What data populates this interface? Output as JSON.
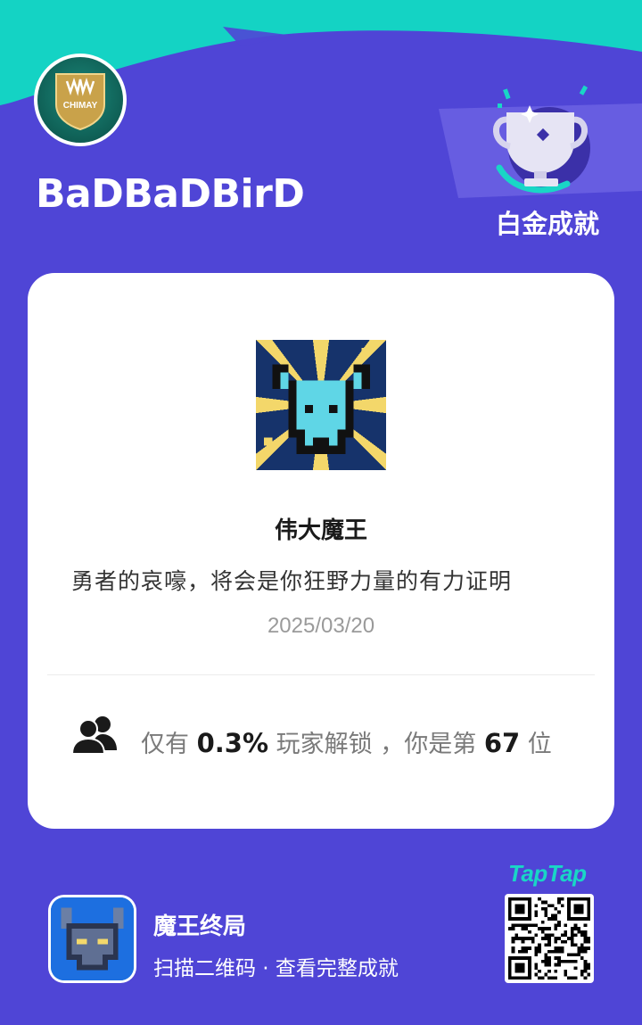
{
  "user": {
    "name": "BaDBaDBirD",
    "avatar_text": "CHIMAY"
  },
  "badge": {
    "label": "白金成就",
    "icon": "trophy-icon"
  },
  "achievement": {
    "title": "伟大魔王",
    "description": "勇者的哀嚎，将会是你狂野力量的有力证明",
    "date": "2025/03/20",
    "icon": "demon-skull-icon"
  },
  "stats": {
    "prefix": "仅有",
    "percent": "0.3%",
    "middle": "玩家解锁 ，你是第",
    "rank": "67",
    "suffix": "位",
    "icon": "users-icon"
  },
  "game": {
    "name": "魔王终局",
    "subtitle": "扫描二维码 · 查看完整成就",
    "icon": "demon-game-icon"
  },
  "brand": "TapTap",
  "colors": {
    "background": "#4f45d6",
    "wave": "#14d3c4",
    "card": "#ffffff",
    "brand": "#19d6c6"
  }
}
